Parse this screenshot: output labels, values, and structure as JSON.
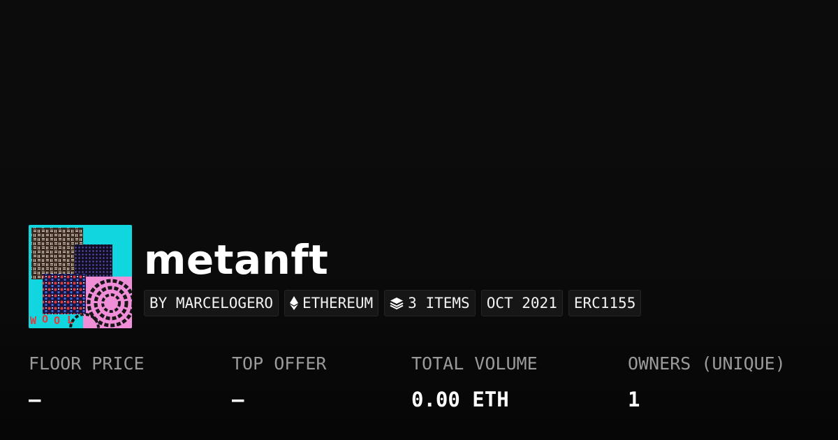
{
  "collection": {
    "name": "metanft",
    "thumbnail_text": "WOOL"
  },
  "tags": {
    "creator": "BY MARCELOGERO",
    "chain": "ETHEREUM",
    "chain_icon": "ethereum-icon",
    "items": "3 ITEMS",
    "items_icon": "layers-icon",
    "date": "OCT 2021",
    "standard": "ERC1155"
  },
  "stats": {
    "floor_price": {
      "label": "FLOOR PRICE",
      "value": "—"
    },
    "top_offer": {
      "label": "TOP OFFER",
      "value": "—"
    },
    "total_volume": {
      "label": "TOTAL VOLUME",
      "value": "0.00 ETH"
    },
    "owners": {
      "label": "OWNERS (UNIQUE)",
      "value": "1"
    }
  },
  "colors": {
    "background": "#0b0b0b",
    "text_primary": "#ffffff",
    "text_secondary": "#9a9a9a",
    "thumb_cyan": "#12d6df",
    "thumb_pink": "#f08fd8"
  }
}
